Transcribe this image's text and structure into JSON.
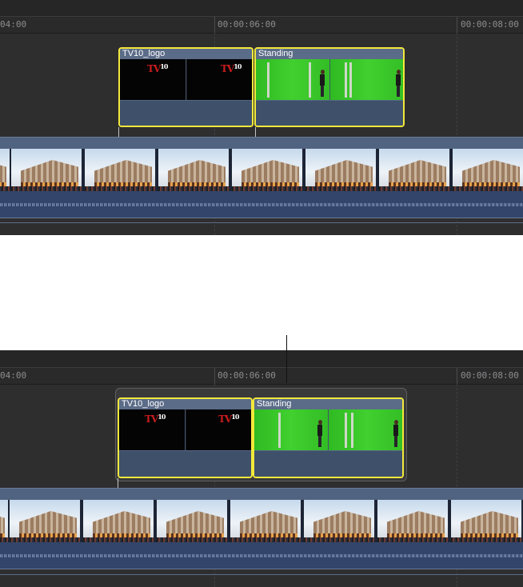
{
  "timeline_before": {
    "ruler": {
      "timecodes": [
        "04:00",
        "00:00:06:00",
        "00:00:08:00"
      ]
    },
    "clips": [
      {
        "name": "TV10_logo",
        "selected": true
      },
      {
        "name": "Standing",
        "selected": true
      }
    ],
    "primary_storyline": {
      "clip_type": "video with audio",
      "thumbnail": "building-street-scene"
    }
  },
  "timeline_after": {
    "ruler": {
      "timecodes": [
        "04:00",
        "00:00:06:00",
        "00:00:08:00"
      ]
    },
    "clips": [
      {
        "name": "TV10_logo",
        "selected": true
      },
      {
        "name": "Standing",
        "selected": true
      }
    ],
    "primary_storyline": {
      "clip_type": "video with audio",
      "thumbnail": "building-street-scene"
    }
  },
  "logo": {
    "letters": "TV",
    "number": "10"
  },
  "colors": {
    "selection": "#f3e93a",
    "clip_body": "#44546d",
    "timeline_bg": "#2e2e2f",
    "green_screen": "#3fcb2c",
    "logo_red": "#c81c1c"
  }
}
